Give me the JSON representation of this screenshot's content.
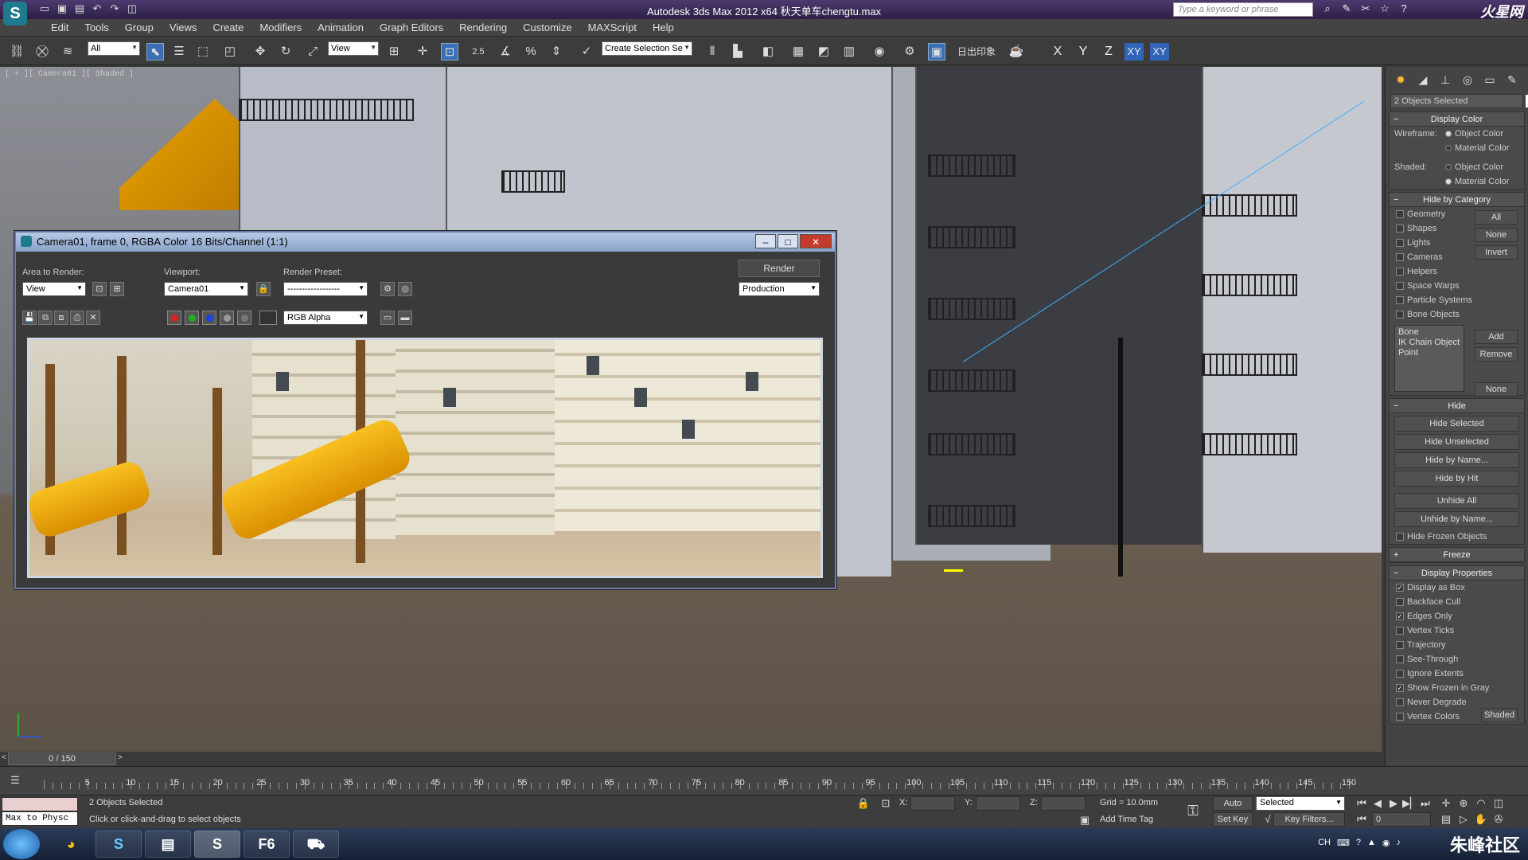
{
  "titlebar": {
    "app_icon": "3ds-max-logo",
    "title": "Autodesk 3ds Max  2012 x64        秋天单车chengtu.max",
    "search_placeholder": "Type a keyword or phrase",
    "logo": "火星网"
  },
  "menu": [
    "Edit",
    "Tools",
    "Group",
    "Views",
    "Create",
    "Modifiers",
    "Animation",
    "Graph Editors",
    "Rendering",
    "Customize",
    "MAXScript",
    "Help"
  ],
  "toolbar": {
    "selection_filter": "All",
    "ref_coord": "View",
    "snap_value": "2.5",
    "selection_set": "Create Selection Se",
    "chinese_label": "日出印象",
    "axes": [
      "X",
      "Y",
      "Z",
      "XY",
      "XY"
    ]
  },
  "viewport": {
    "label": "[ + ][ Camera01 ][ Shaded ]"
  },
  "render_window": {
    "title": "Camera01, frame 0, RGBA Color 16 Bits/Channel (1:1)",
    "area_label": "Area to Render:",
    "area_value": "View",
    "viewport_label": "Viewport:",
    "viewport_value": "Camera01",
    "preset_label": "Render Preset:",
    "preset_value": "------------------",
    "render_button": "Render",
    "production_value": "Production",
    "channel_value": "RGB Alpha"
  },
  "command_panel": {
    "name_field": "2 Objects Selected",
    "display_color": {
      "header": "Display Color",
      "wireframe_label": "Wireframe:",
      "shaded_label": "Shaded:",
      "object_color": "Object Color",
      "material_color": "Material Color"
    },
    "hide_by_category": {
      "header": "Hide by Category",
      "items": [
        "Geometry",
        "Shapes",
        "Lights",
        "Cameras",
        "Helpers",
        "Space Warps",
        "Particle Systems",
        "Bone Objects"
      ],
      "buttons": [
        "All",
        "None",
        "Invert"
      ],
      "list": [
        "Bone",
        "IK Chain Object",
        "Point"
      ],
      "add": "Add",
      "remove": "Remove",
      "none": "None"
    },
    "hide": {
      "header": "Hide",
      "buttons": [
        "Hide Selected",
        "Hide Unselected",
        "Hide by Name...",
        "Hide by Hit",
        "Unhide All",
        "Unhide by Name..."
      ],
      "hide_frozen": "Hide Frozen Objects"
    },
    "freeze": {
      "header": "Freeze"
    },
    "display_properties": {
      "header": "Display Properties",
      "items": [
        {
          "label": "Display as Box",
          "checked": true
        },
        {
          "label": "Backface Cull",
          "checked": false
        },
        {
          "label": "Edges Only",
          "checked": true
        },
        {
          "label": "Vertex Ticks",
          "checked": false
        },
        {
          "label": "Trajectory",
          "checked": false
        },
        {
          "label": "See-Through",
          "checked": false
        },
        {
          "label": "Ignore Extents",
          "checked": false
        },
        {
          "label": "Show Frozen in Gray",
          "checked": true
        },
        {
          "label": "Never Degrade",
          "checked": false
        },
        {
          "label": "Vertex Colors",
          "checked": false
        }
      ],
      "shaded_button": "Shaded"
    }
  },
  "timeline": {
    "frame_display": "0 / 150",
    "ticks": [
      0,
      5,
      10,
      15,
      20,
      25,
      30,
      35,
      40,
      45,
      50,
      55,
      60,
      65,
      70,
      75,
      80,
      85,
      90,
      95,
      100,
      105,
      110,
      115,
      120,
      125,
      130,
      135,
      140,
      145,
      150
    ],
    "tick_labels": [
      "5",
      "10",
      "15",
      "20",
      "25",
      "30",
      "35",
      "40",
      "45",
      "50",
      "55",
      "60",
      "65",
      "70",
      "75",
      "80",
      "85",
      "90",
      "95",
      "100",
      "105",
      "110",
      "115",
      "120",
      "125",
      "130",
      "135",
      "140",
      "145",
      "150"
    ]
  },
  "statusbar": {
    "maxscript_listener": "Max to Physc",
    "selection_status": "2 Objects Selected",
    "prompt": "Click or click-and-drag to select objects",
    "x_label": "X:",
    "y_label": "Y:",
    "z_label": "Z:",
    "grid": "Grid = 10.0mm",
    "add_time_tag": "Add Time Tag",
    "auto_key": "Auto Key",
    "set_key": "Set Key",
    "selected": "Selected",
    "key_filters": "Key Filters...",
    "frame_field": "0"
  },
  "taskbar": {
    "items": [
      "start-orb",
      "s-app",
      "file-explorer",
      "3ds-max",
      "F6",
      "game"
    ],
    "f6_label": "F6",
    "watermark": "朱峰社区"
  }
}
